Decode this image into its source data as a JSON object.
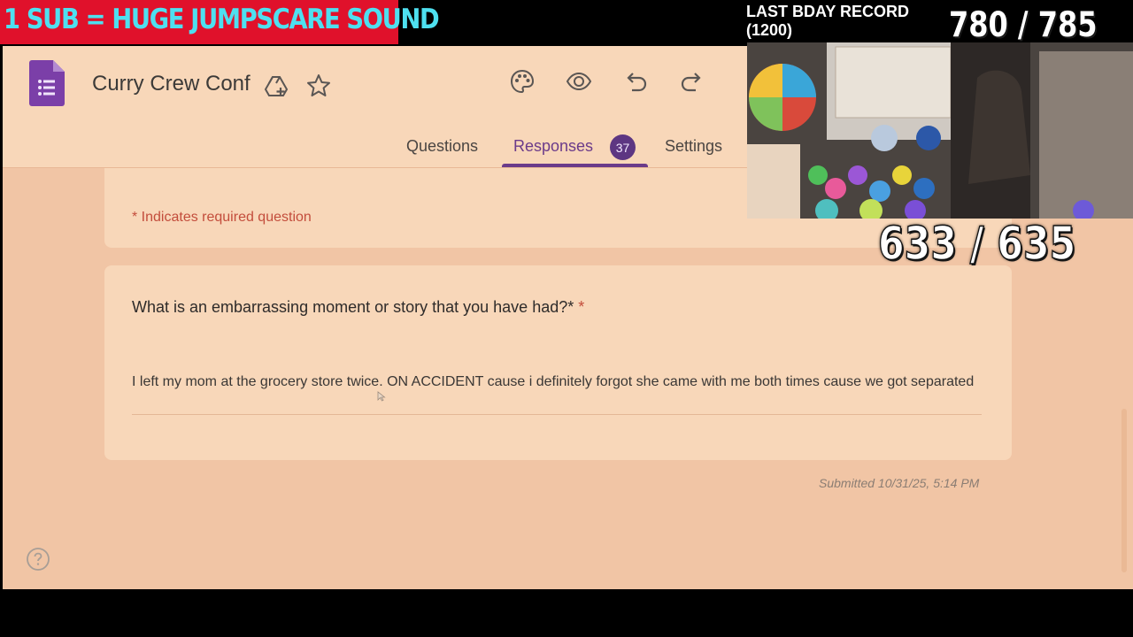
{
  "overlay": {
    "banner": "1 SUB = HUGE JUMPSCARE SOUND",
    "record_line1": "LAST BDAY RECORD",
    "record_line2": "(1200)",
    "counter_top": "780 / 785",
    "counter_mid": "633 / 635"
  },
  "form": {
    "title": "Curry Crew Conf",
    "tabs": {
      "questions": "Questions",
      "responses": "Responses",
      "settings": "Settings"
    },
    "responses_count": "37",
    "required_note": "* Indicates required question",
    "question": "What is an embarrassing moment or story that you have had?*",
    "required_star": "*",
    "answer": "I left my mom at the grocery store twice. ON ACCIDENT cause i definitely forgot she came with me both times cause we got separated",
    "submitted": "Submitted 10/31/25, 5:14 PM"
  },
  "icons": {
    "logo": "google-forms-logo",
    "title_actions": [
      "drive-add-icon",
      "star-icon"
    ],
    "toolbar": [
      "palette-icon",
      "eye-icon",
      "undo-icon",
      "redo-icon"
    ],
    "help": "help-icon"
  },
  "colors": {
    "accent": "#6b3b8a",
    "required": "#c34d3c",
    "banner_bg": "#e0112b",
    "banner_text": "#4ee0f0"
  }
}
